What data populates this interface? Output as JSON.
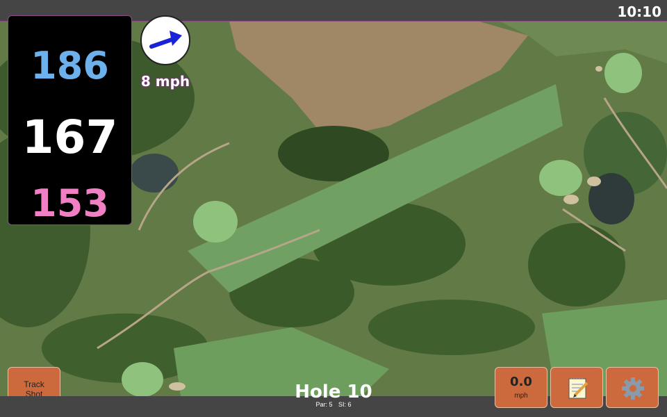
{
  "status_bar": {
    "time": "10:10"
  },
  "distances": {
    "back": "186",
    "center": "167",
    "front": "153"
  },
  "wind": {
    "speed_label": "8 mph",
    "icon": "wind-arrow-icon"
  },
  "buttons": {
    "track_shot_line1": "Track",
    "track_shot_line2": "Shot",
    "speed_value": "0.0",
    "speed_unit": "mph",
    "notes_icon": "notepad-icon",
    "settings_icon": "gear-icon"
  },
  "hole": {
    "title": "Hole 10",
    "par": "Par: 5",
    "si": "SI: 6"
  },
  "colors": {
    "back": "#6cb1ec",
    "center": "#ffffff",
    "front": "#f07fc4",
    "button": "#cc6a3e"
  }
}
